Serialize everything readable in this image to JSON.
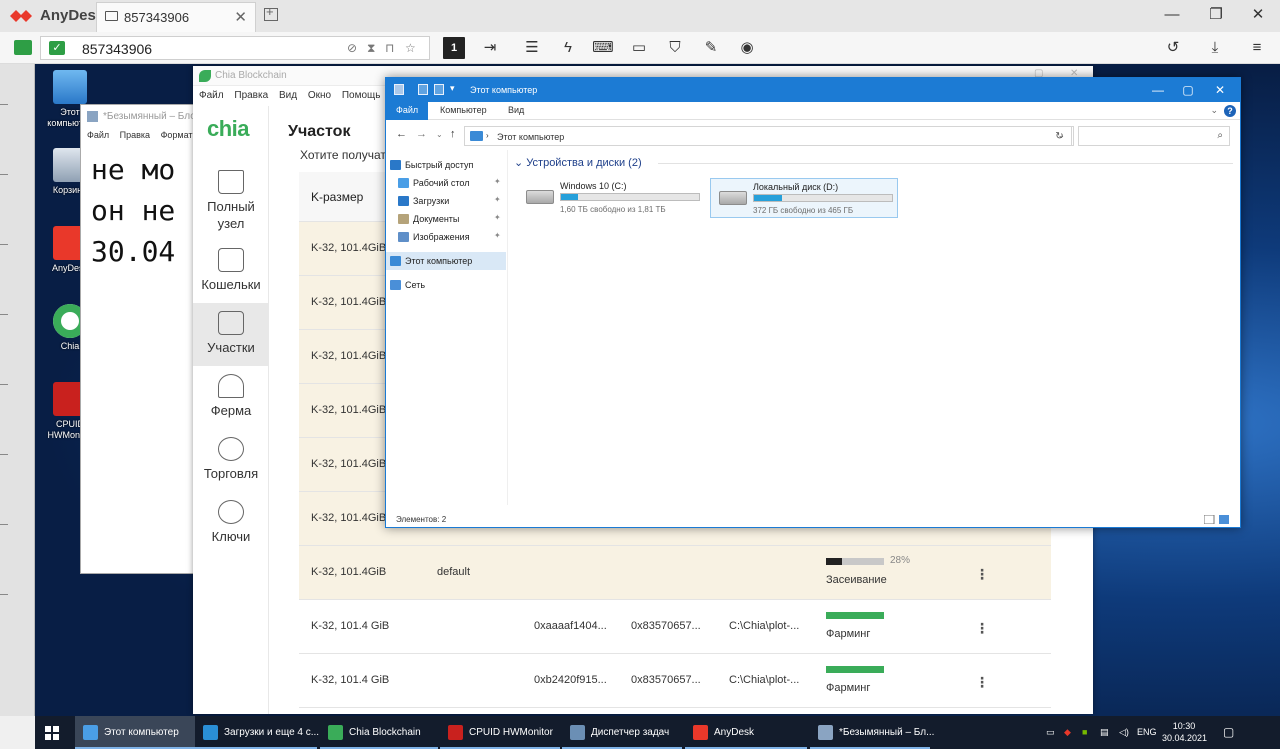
{
  "anydesk": {
    "brand": "AnyDesk",
    "tab_label": "857343906",
    "address_value": "857343906",
    "monitor_label": "1",
    "accent_color": "#e9382a"
  },
  "notepad": {
    "title": "*Безымянный – Блокнот",
    "menu": [
      "Файл",
      "Правка",
      "Формат"
    ],
    "text_lines": [
      "не мо",
      "он не",
      "30.04"
    ]
  },
  "desktop": {
    "icons": [
      {
        "label": "Этот компьютер",
        "icon": "computer-icon"
      },
      {
        "label": "Корзина",
        "icon": "recycle-bin-icon"
      },
      {
        "label": "AnyDesk",
        "icon": "anydesk-icon"
      },
      {
        "label": "Chia",
        "icon": "chia-icon"
      },
      {
        "label": "CPUID HWMonitor",
        "icon": "hwmonitor-icon"
      }
    ]
  },
  "chia": {
    "window_title": "Chia Blockchain",
    "menu": [
      "Файл",
      "Правка",
      "Вид",
      "Окно",
      "Помощь"
    ],
    "logo": "chia",
    "page_title": "Участок",
    "ask_text": "Хотите получать",
    "nav": [
      {
        "label": "Полный узел",
        "icon": "home-icon",
        "active": false
      },
      {
        "label": "Кошельки",
        "icon": "wallet-icon",
        "active": false
      },
      {
        "label": "Участки",
        "icon": "drive-icon",
        "active": true
      },
      {
        "label": "Ферма",
        "icon": "sprout-icon",
        "active": false
      },
      {
        "label": "Торговля",
        "icon": "trade-icon",
        "active": false
      },
      {
        "label": "Ключи",
        "icon": "keys-icon",
        "active": false
      }
    ],
    "table_header": {
      "k_size": "K-размер"
    },
    "rows": [
      {
        "k": "K-32, 101.4GiB",
        "queue": "",
        "farmer_key": "",
        "pool_key": "",
        "path": "",
        "status": "",
        "progress": null
      },
      {
        "k": "K-32, 101.4GiB",
        "queue": "",
        "farmer_key": "",
        "pool_key": "",
        "path": "",
        "status": "",
        "progress": null
      },
      {
        "k": "K-32, 101.4GiB",
        "queue": "",
        "farmer_key": "",
        "pool_key": "",
        "path": "",
        "status": "",
        "progress": null
      },
      {
        "k": "K-32, 101.4GiB",
        "queue": "",
        "farmer_key": "",
        "pool_key": "",
        "path": "",
        "status": "",
        "progress": null
      },
      {
        "k": "K-32, 101.4GiB",
        "queue": "",
        "farmer_key": "",
        "pool_key": "",
        "path": "",
        "status": "",
        "progress": null
      },
      {
        "k": "K-32, 101.4GiB",
        "queue": "",
        "farmer_key": "",
        "pool_key": "",
        "path": "",
        "status": "",
        "progress": null
      },
      {
        "k": "K-32, 101.4GiB",
        "queue": "default",
        "farmer_key": "",
        "pool_key": "",
        "path": "",
        "status": "Засеивание",
        "progress_label": "28%",
        "progress": 0.28
      },
      {
        "k": "K-32, 101.4 GiB",
        "queue": "",
        "farmer_key": "0xaaaaf1404...",
        "pool_key": "0x83570657...",
        "path": "C:\\Chia\\plot-...",
        "status": "Фарминг",
        "progress": 1
      },
      {
        "k": "K-32, 101.4 GiB",
        "queue": "",
        "farmer_key": "0xb2420f915...",
        "pool_key": "0x83570657...",
        "path": "C:\\Chia\\plot-...",
        "status": "Фарминг",
        "progress": 1
      }
    ],
    "accent_color": "#3aac59"
  },
  "explorer": {
    "title": "Этот компьютер",
    "ribbon_tabs": [
      "Файл",
      "Компьютер",
      "Вид"
    ],
    "address": "Этот компьютер",
    "nav": [
      {
        "label": "Быстрый доступ",
        "icon": "star-icon",
        "pinned": false
      },
      {
        "label": "Рабочий стол",
        "icon": "desktop-icon",
        "pinned": true
      },
      {
        "label": "Загрузки",
        "icon": "download-icon",
        "pinned": true
      },
      {
        "label": "Документы",
        "icon": "documents-icon",
        "pinned": true
      },
      {
        "label": "Изображения",
        "icon": "pictures-icon",
        "pinned": true
      },
      {
        "label": "Этот компьютер",
        "icon": "computer-icon",
        "pinned": false,
        "selected": true
      },
      {
        "label": "Сеть",
        "icon": "network-icon",
        "pinned": false
      }
    ],
    "group_label": "Устройства и диски (2)",
    "drives": [
      {
        "name": "Windows 10 (C:)",
        "free_text": "1,60 ТБ свободно из 1,81 ТБ",
        "used_fraction": 0.12,
        "selected": false
      },
      {
        "name": "Локальный диск (D:)",
        "free_text": "372 ГБ свободно из 465 ГБ",
        "used_fraction": 0.2,
        "selected": true
      }
    ],
    "status": "Элементов: 2"
  },
  "taskbar": {
    "items": [
      {
        "label": "Этот компьютер",
        "icon": "explorer-icon",
        "active": true
      },
      {
        "label": "Загрузки и еще 4 с...",
        "icon": "edge-icon",
        "active": false
      },
      {
        "label": "Chia Blockchain",
        "icon": "chia-icon",
        "active": false
      },
      {
        "label": "CPUID HWMonitor",
        "icon": "hwmonitor-icon",
        "active": false
      },
      {
        "label": "Диспетчер задач",
        "icon": "task-manager-icon",
        "active": false
      },
      {
        "label": "AnyDesk",
        "icon": "anydesk-icon",
        "active": false
      },
      {
        "label": "*Безымянный – Бл...",
        "icon": "notepad-icon",
        "active": false
      }
    ],
    "lang": "ENG",
    "time": "10:30",
    "date": "30.04.2021"
  }
}
